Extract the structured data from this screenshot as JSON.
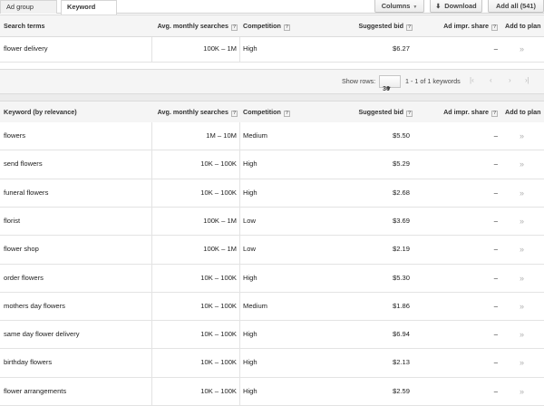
{
  "tabs": [
    "Ad group ideas",
    "Keyword ideas"
  ],
  "toolbar": {
    "columns": "Columns",
    "download": "Download",
    "add_all": "Add all (541)"
  },
  "search_terms_table": {
    "headers": {
      "keyword": "Search terms",
      "searches": "Avg. monthly searches",
      "competition": "Competition",
      "bid": "Suggested bid",
      "share": "Ad impr. share",
      "plan": "Add to plan"
    },
    "rows": [
      {
        "keyword": "flower delivery",
        "searches": "100K – 1M",
        "competition": "High",
        "bid": "$6.27",
        "share": "–",
        "plan": "»"
      }
    ]
  },
  "pager": {
    "show_rows_label": "Show rows:",
    "rows_value": "30",
    "range": "1 - 1 of 1 keywords"
  },
  "ideas_table": {
    "headers": {
      "keyword": "Keyword (by relevance)",
      "searches": "Avg. monthly searches",
      "competition": "Competition",
      "bid": "Suggested bid",
      "share": "Ad impr. share",
      "plan": "Add to plan"
    },
    "rows": [
      {
        "keyword": "flowers",
        "searches": "1M – 10M",
        "competition": "Medium",
        "bid": "$5.50",
        "share": "–",
        "plan": "»"
      },
      {
        "keyword": "send flowers",
        "searches": "10K – 100K",
        "competition": "High",
        "bid": "$5.29",
        "share": "–",
        "plan": "»"
      },
      {
        "keyword": "funeral flowers",
        "searches": "10K – 100K",
        "competition": "High",
        "bid": "$2.68",
        "share": "–",
        "plan": "»"
      },
      {
        "keyword": "florist",
        "searches": "100K – 1M",
        "competition": "Low",
        "bid": "$3.69",
        "share": "–",
        "plan": "»"
      },
      {
        "keyword": "flower shop",
        "searches": "100K – 1M",
        "competition": "Low",
        "bid": "$2.19",
        "share": "–",
        "plan": "»"
      },
      {
        "keyword": "order flowers",
        "searches": "10K – 100K",
        "competition": "High",
        "bid": "$5.30",
        "share": "–",
        "plan": "»"
      },
      {
        "keyword": "mothers day flowers",
        "searches": "10K – 100K",
        "competition": "Medium",
        "bid": "$1.86",
        "share": "–",
        "plan": "»"
      },
      {
        "keyword": "same day flower delivery",
        "searches": "10K – 100K",
        "competition": "High",
        "bid": "$6.94",
        "share": "–",
        "plan": "»"
      },
      {
        "keyword": "birthday flowers",
        "searches": "10K – 100K",
        "competition": "High",
        "bid": "$2.13",
        "share": "–",
        "plan": "»"
      },
      {
        "keyword": "flower arrangements",
        "searches": "10K – 100K",
        "competition": "High",
        "bid": "$2.59",
        "share": "–",
        "plan": "»"
      }
    ]
  }
}
